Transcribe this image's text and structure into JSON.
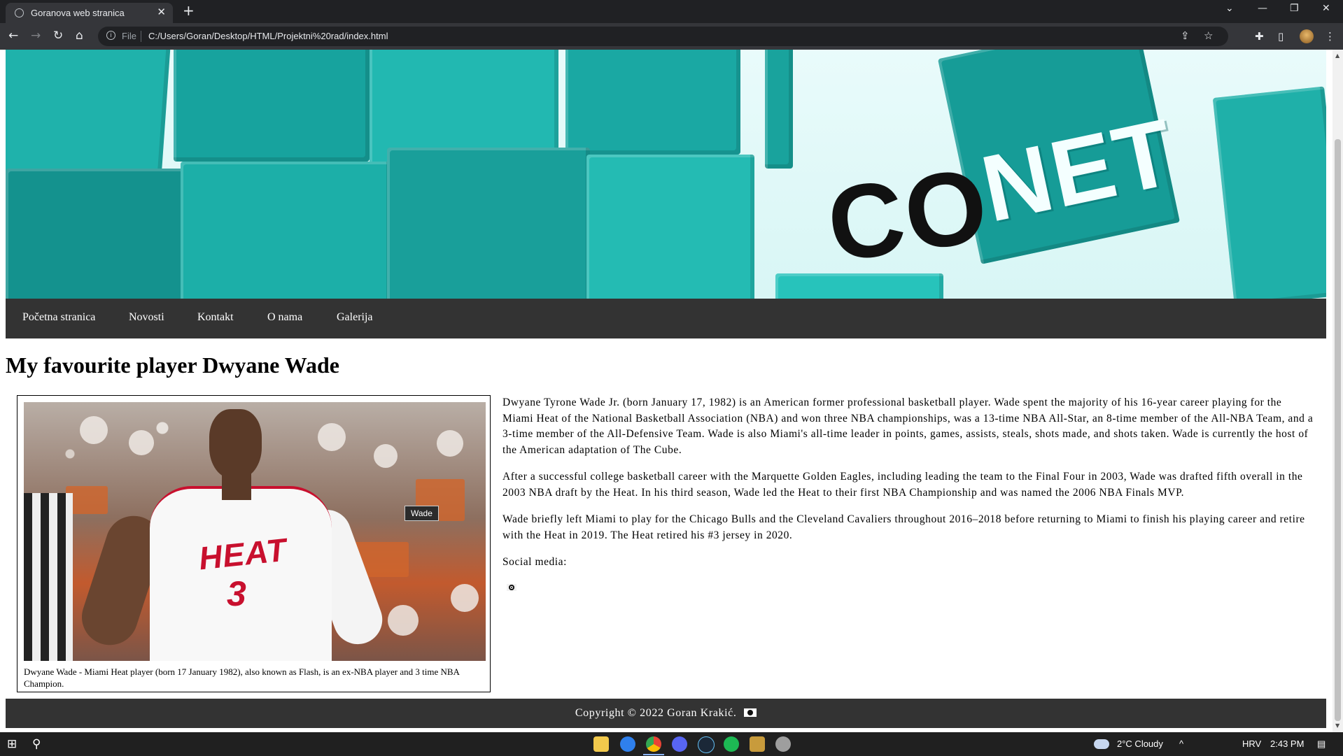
{
  "browser": {
    "tab_title": "Goranova web stranica",
    "tab_close": "✕",
    "new_tab": "+",
    "window_controls": {
      "dropdown": "⌄",
      "minimize": "—",
      "restore": "❐",
      "close": "✕"
    },
    "nav": {
      "back": "←",
      "forward": "→",
      "reload": "↻",
      "home": "⌂"
    },
    "address": {
      "scheme_label": "File",
      "url": "C:/Users/Goran/Desktop/HTML/Projektni%20rad/index.html",
      "info_icon": "i"
    },
    "toolbar_icons": {
      "share": "⇪",
      "bookmark": "☆",
      "extensions": "✚",
      "sidepanel": "▯",
      "menu": "⋮"
    }
  },
  "page": {
    "banner": {
      "logo_dark": "CO",
      "logo_light": "NET"
    },
    "nav_links": [
      "Početna stranica",
      "Novosti",
      "Kontakt",
      "O nama",
      "Galerija"
    ],
    "heading": "My favourite player Dwyane Wade",
    "figure": {
      "jersey_text": "HEAT",
      "jersey_number": "3",
      "tooltip": "Wade",
      "caption": "Dwyane Wade - Miami Heat player (born 17 January 1982), also known as Flash, is an ex-NBA player and 3 time NBA Champion."
    },
    "paragraphs": [
      "Dwyane Tyrone Wade Jr. (born January 17, 1982) is an American former professional basketball player. Wade spent the majority of his 16-year career playing for the Miami Heat of the National Basketball Association (NBA) and won three NBA championships, was a 13-time NBA All-Star, an 8-time member of the All-NBA Team, and a 3-time member of the All-Defensive Team. Wade is also Miami's all-time leader in points, games, assists, steals, shots made, and shots taken. Wade is currently the host of the American adaptation of The Cube.",
      "After a successful college basketball career with the Marquette Golden Eagles, including leading the team to the Final Four in 2003, Wade was drafted fifth overall in the 2003 NBA draft by the Heat. In his third season, Wade led the Heat to their first NBA Championship and was named the 2006 NBA Finals MVP.",
      "Wade briefly left Miami to play for the Chicago Bulls and the Cleveland Cavaliers throughout 2016–2018 before returning to Miami to finish his playing career and retire with the Heat in 2019. The Heat retired his #3 jersey in 2020."
    ],
    "social_label": "Social media:",
    "footer": "Copyright © 2022 Goran Krakić."
  },
  "taskbar": {
    "weather": "2°C  Cloudy",
    "language": "HRV",
    "time": "2:43 PM",
    "start_icon": "⊞",
    "search_icon": "⚲",
    "tray_chevron": "^",
    "notification_icon": "▤"
  },
  "colors": {
    "chrome_dark": "#202124",
    "chrome_mid": "#35363a",
    "page_nav": "#333333",
    "banner_teal": "#1aa8a3",
    "heat_red": "#c8102e"
  }
}
